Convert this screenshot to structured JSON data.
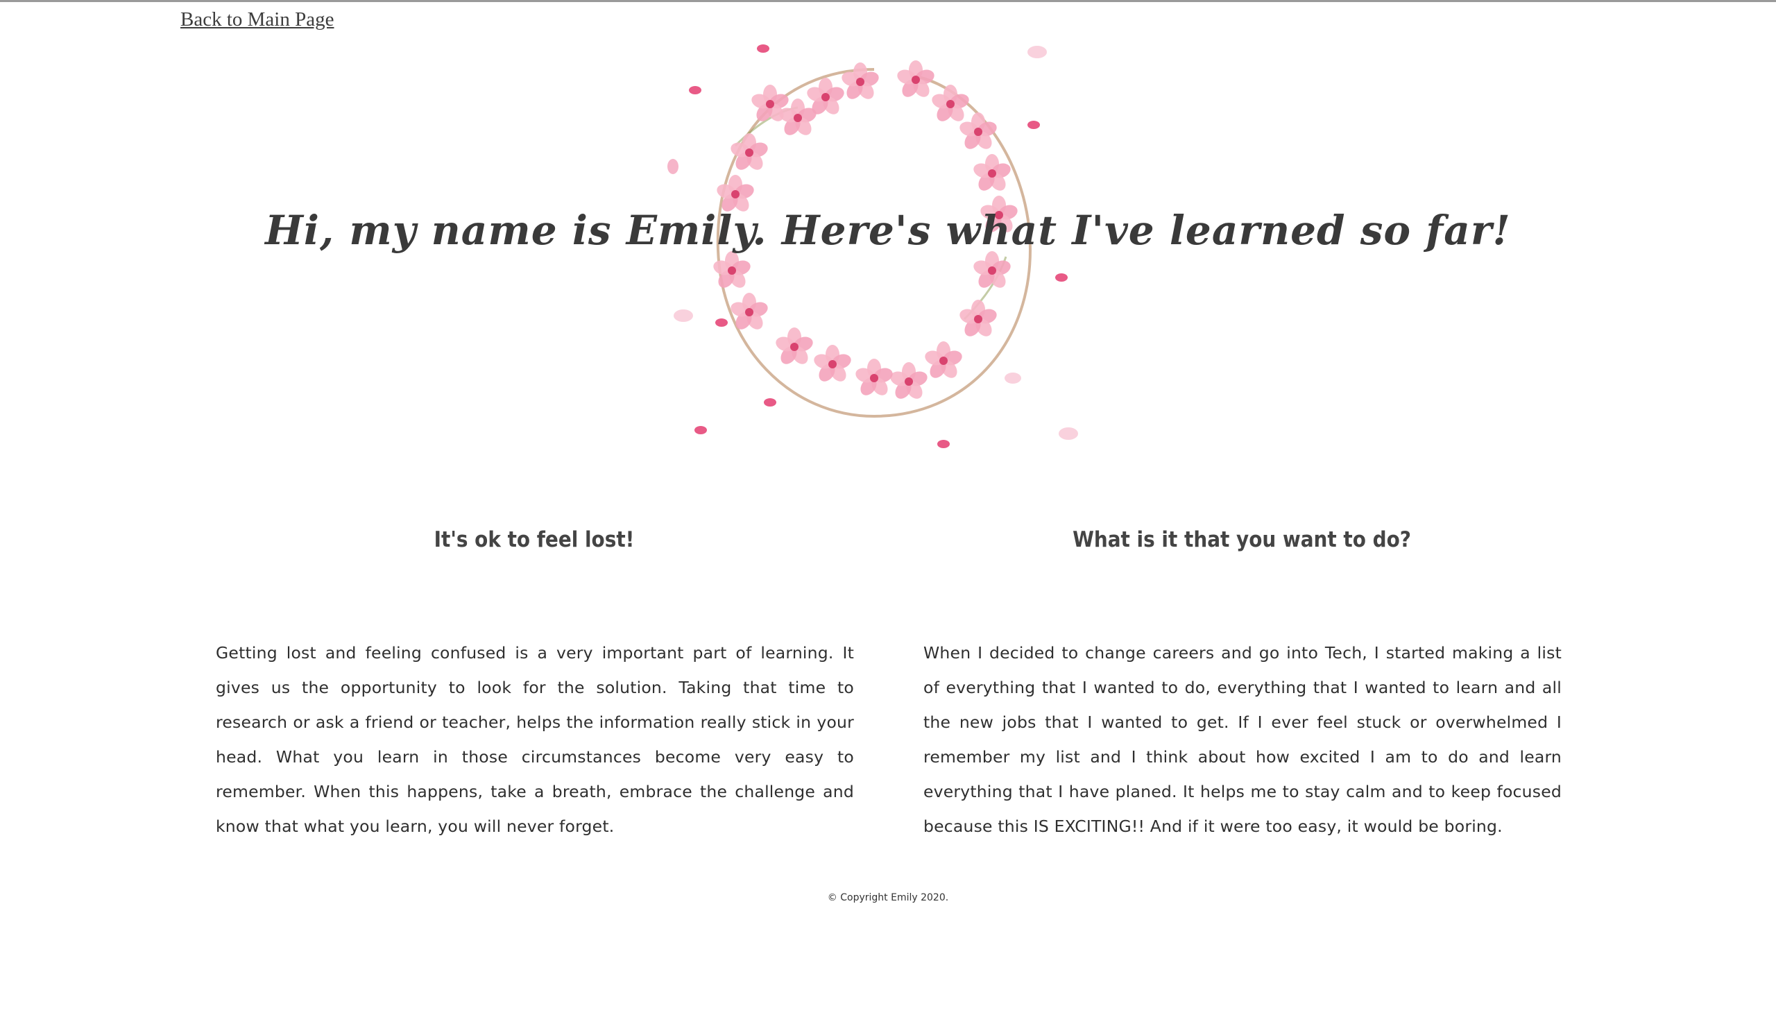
{
  "nav": {
    "back_link": "Back to Main Page"
  },
  "hero": {
    "title": "Hi, my name is Emily. Here's what I've learned so far!",
    "decoration_icon": "cherry-blossom-wreath"
  },
  "columns": [
    {
      "heading": "It's ok to feel lost!",
      "body": "Getting lost and feeling confused is a very important part of learning. It gives us the opportunity to look for the solution. Taking that time to research or ask a friend or teacher, helps the information really stick in your head. What you learn in those circumstances become very easy to remember. When this happens, take a breath, embrace the challenge and know that what you learn, you will never forget."
    },
    {
      "heading": "What is it that you want to do?",
      "body": "When I decided to change careers and go into Tech, I started making a list of everything that I wanted to do, everything that I wanted to learn and all the new jobs that I wanted to get. If I ever feel stuck or overwhelmed I remember my list and I think about how excited I am to do and learn everything that I have planed. It helps me to stay calm and to keep focused because this IS EXCITING!! And if it were too easy, it would be boring."
    }
  ],
  "footer": {
    "copyright": "© Copyright Emily 2020."
  },
  "colors": {
    "text": "#3d3d3d",
    "petal_dark": "#e85a86",
    "petal_light": "#f7b6c8",
    "branch": "#b07a4d"
  }
}
